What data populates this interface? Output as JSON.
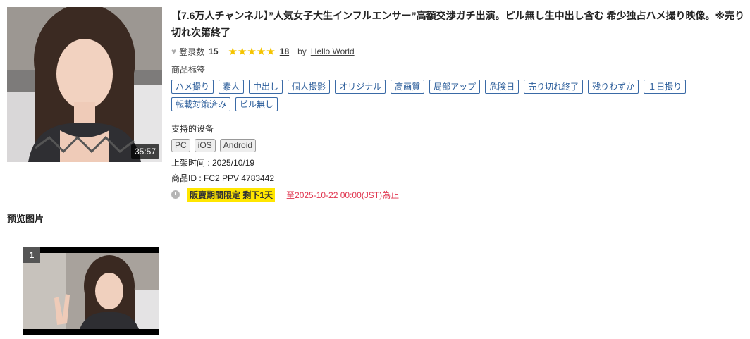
{
  "product": {
    "title": "【7.6万人チャンネル】”人気女子大生インフルエンサー”高額交渉ガチ出演。ピル無し生中出し含む 希少独占ハメ撮り映像。※売り切れ次第終了",
    "duration": "35:57",
    "favorites_label": "登录数",
    "favorites_count": "15",
    "rating_stars": 5,
    "review_count": "18",
    "by_label": "by",
    "author": "Hello World"
  },
  "tags_section": {
    "label": "商品标签",
    "tags": [
      "ハメ撮り",
      "素人",
      "中出し",
      "個人撮影",
      "オリジナル",
      "高画質",
      "局部アップ",
      "危険日",
      "売り切れ終了",
      "残りわずか",
      "１日撮り",
      "転載対策済み",
      "ピル無し"
    ]
  },
  "devices_section": {
    "label": "支持的设备",
    "devices": [
      "PC",
      "iOS",
      "Android"
    ]
  },
  "details": {
    "release_date": "上架时间 : 2025/10/19",
    "product_id": "商品ID : FC2 PPV 4783442"
  },
  "sale": {
    "badge": "販賣期間限定 剩下1天",
    "until": "至2025-10-22 00:00(JST)為止"
  },
  "preview": {
    "title": "预览图片",
    "images": [
      {
        "number": "1"
      }
    ]
  },
  "colors": {
    "star": "#f5c400",
    "tag_border": "#3a6aa6",
    "sale_badge_bg": "#ffe600",
    "sale_until": "#e0344e"
  },
  "icons": [
    "heart-icon",
    "star-icon",
    "clock-icon"
  ]
}
